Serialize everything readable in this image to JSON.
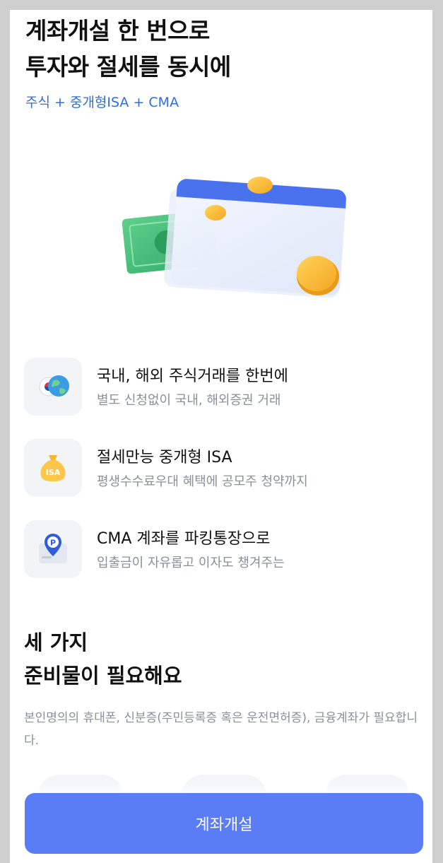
{
  "header": {
    "title_line1": "계좌개설 한 번으로",
    "title_line2": "투자와 절세를 동시에",
    "subtitle": "주식 + 중개형ISA + CMA"
  },
  "colors": {
    "accent": "#5a7cf5",
    "subtitle_blue": "#2f6fd6"
  },
  "features": [
    {
      "icon": "globe-flag-icon",
      "title": "국내, 해외 주식거래를 한번에",
      "desc": "별도 신청없이 국내, 해외증권 거래"
    },
    {
      "icon": "isa-moneybag-icon",
      "title": "절세만능 중개형 ISA",
      "desc": "평생수수료우대 혜택에 공모주 청약까지"
    },
    {
      "icon": "parking-pin-icon",
      "title": "CMA 계좌를 파킹통장으로",
      "desc": "입출금이 자유롭고 이자도 챙겨주는"
    }
  ],
  "requirements": {
    "title_line1": "세 가지",
    "title_line2": "준비물이 필요해요",
    "desc": "본인명의의 휴대폰, 신분증(주민등록증 혹은 운전면허증), 금융계좌가 필요합니다."
  },
  "bag_label": "ISA",
  "pin_label": "P",
  "cta": {
    "label": "계좌개설"
  }
}
